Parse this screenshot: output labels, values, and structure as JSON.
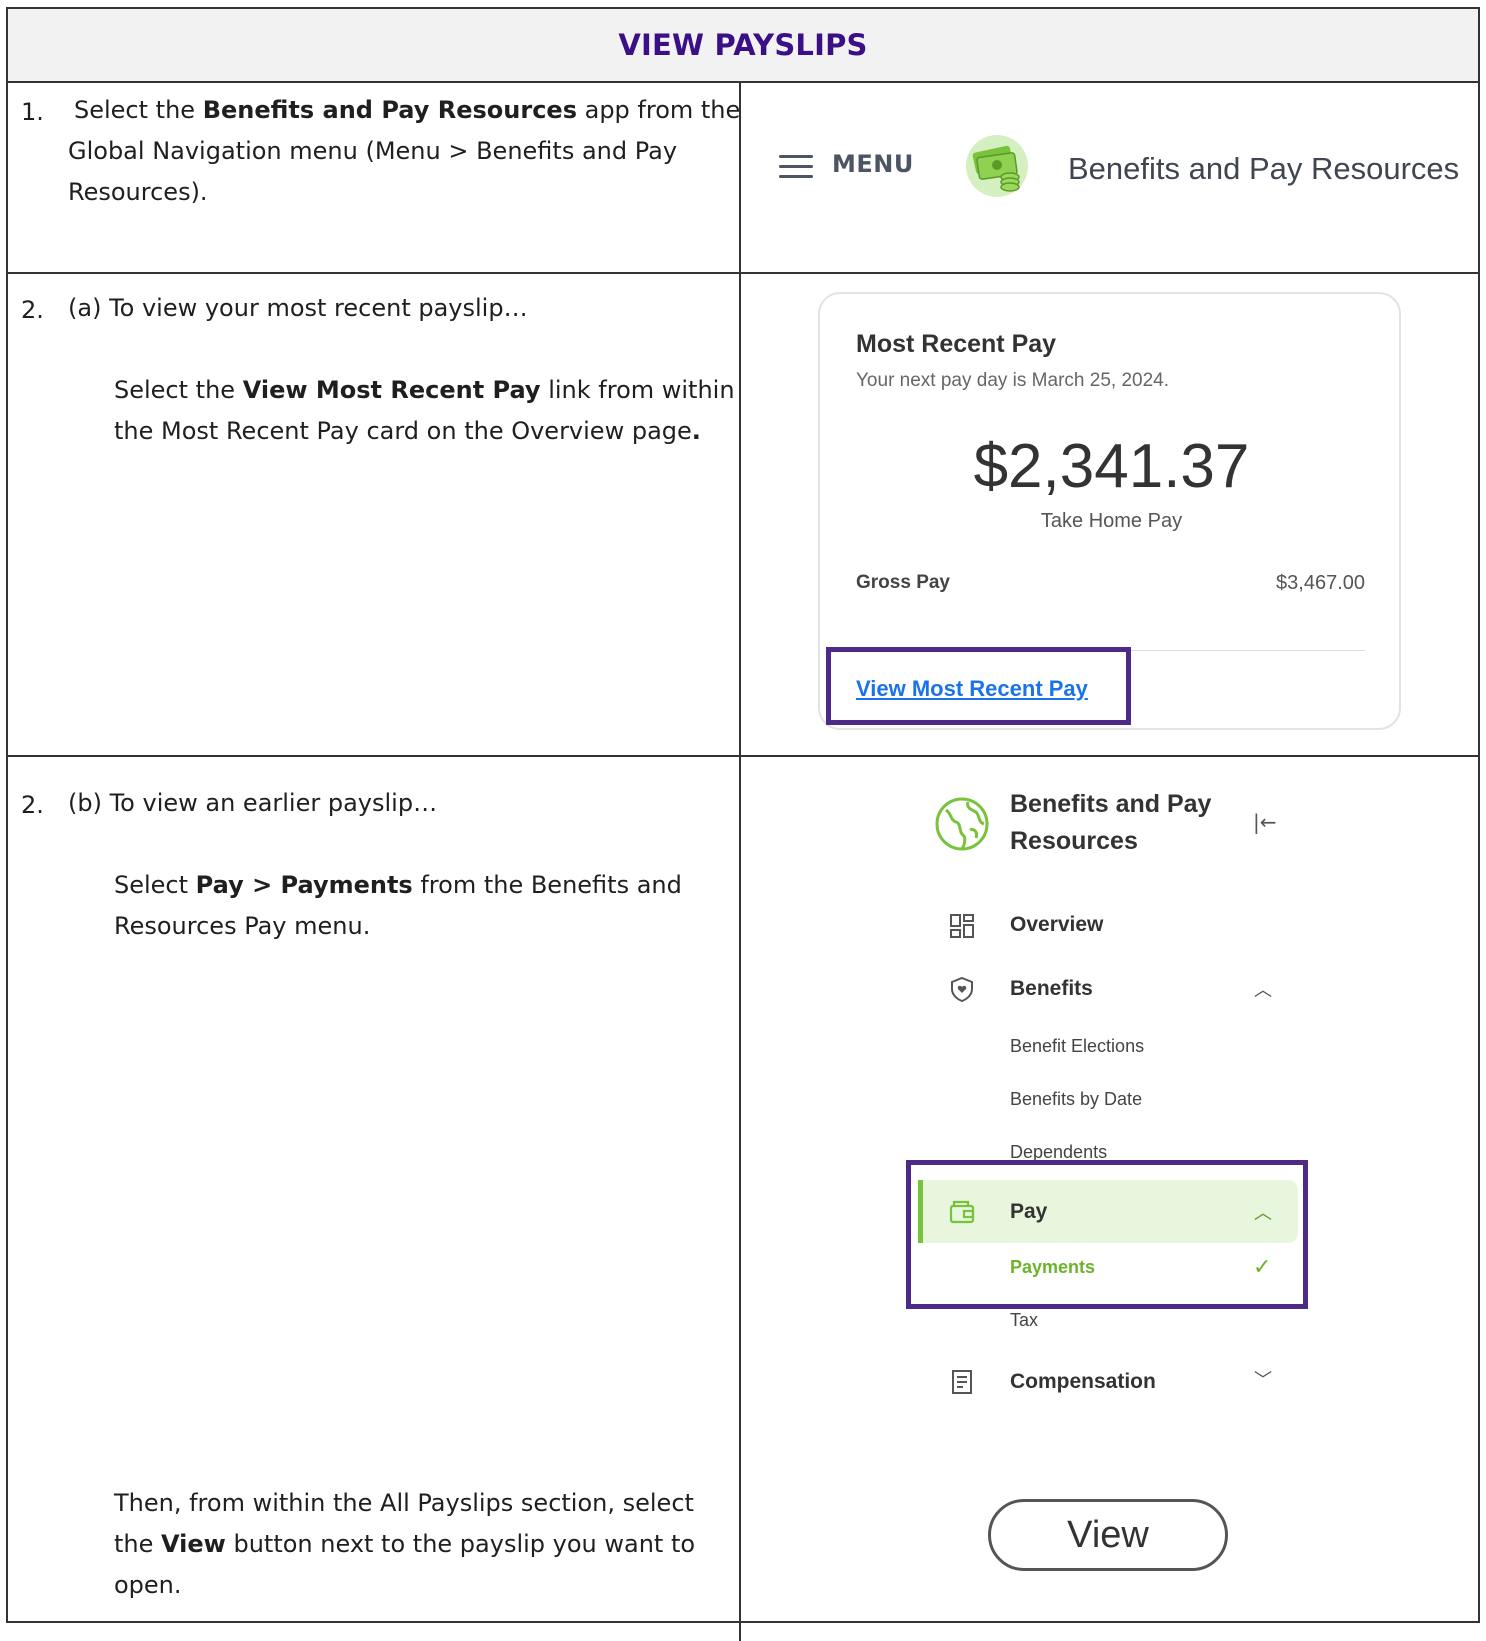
{
  "title": "VIEW PAYSLIPS",
  "steps": {
    "s1_num": "1.",
    "s1_a": "Select the ",
    "s1_b": "Benefits and Pay Resources",
    "s1_c": " app from the",
    "s1_line2": "Global Navigation menu (Menu > Benefits and Pay",
    "s1_line3": "Resources).",
    "s2a_num": "2.",
    "s2a_head": "(a)  To view your most recent payslip…",
    "s2a_p1": "Select the ",
    "s2a_p2": "View Most Recent Pay",
    "s2a_p3": " link from within",
    "s2a_line2a": "the Most Recent Pay card on the Overview page",
    "s2a_line2b": ".",
    "s2b_num": "2.",
    "s2b_head": "(b)  To view an earlier payslip…",
    "s2b_p1": "Select ",
    "s2b_p2": "Pay > Payments",
    "s2b_p3": " from the Benefits and",
    "s2b_line2": "Resources Pay menu.",
    "s2b_then1": "Then, from within the All Payslips section, select",
    "s2b_then2a": "the ",
    "s2b_then2b": "View",
    "s2b_then2c": " button next to the payslip you want to",
    "s2b_then3": "open."
  },
  "menu_bar": {
    "menu_label": "MENU",
    "app_title": "Benefits and Pay Resources",
    "menu_icon": "hamburger-icon",
    "app_icon": "money-stack-icon"
  },
  "card": {
    "title": "Most Recent Pay",
    "subtitle": "Your next pay day is March 25, 2024.",
    "amount": "$2,341.37",
    "amount_label": "Take Home Pay",
    "gross_label": "Gross Pay",
    "gross_value": "$3,467.00",
    "link": "View Most Recent Pay"
  },
  "nav": {
    "title_line1": "Benefits and Pay",
    "title_line2": "Resources",
    "collapse": "|←",
    "overview": "Overview",
    "benefits": "Benefits",
    "benefit_elections": "Benefit Elections",
    "benefits_by_date": "Benefits by Date",
    "dependents": "Dependents",
    "pay": "Pay",
    "payments": "Payments",
    "tax": "Tax",
    "compensation": "Compensation"
  },
  "view_button": "View",
  "colors": {
    "title": "#3b0f86",
    "highlight_box": "#4c2a85",
    "link": "#1a73e8",
    "green": "#78c23c"
  }
}
